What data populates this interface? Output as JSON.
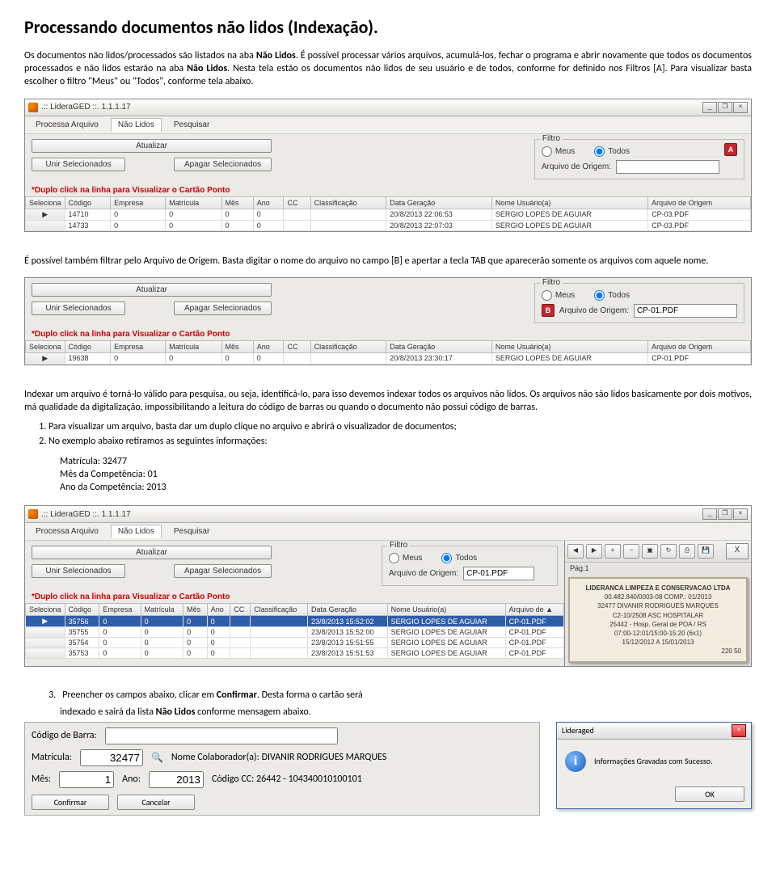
{
  "heading": "Processando documentos não lidos (Indexação).",
  "para1a": "Os documentos não lidos/processados são listados na aba ",
  "para1b": "Não Lidos",
  "para1c": ". É possível processar vários arquivos, acumulá-los, fechar o programa e abrir novamente que todos os documentos processados e não lidos estarão na aba ",
  "para1d": "Não Lidos",
  "para1e": ". Nesta tela estão os documentos não lidos de seu usuário e de todos, conforme for definido nos Filtros [A]. Para visualizar basta escolher o filtro \"Meus\" ou \"Todos\", conforme tela abaixo.",
  "app": {
    "title": ".:: LideraGED ::. 1.1.1.17",
    "tabs": [
      "Processa Arquivo",
      "Não Lidos",
      "Pesquisar"
    ],
    "buttons": {
      "atualizar": "Atualizar",
      "unir": "Unir Selecionados",
      "apagar": "Apagar Selecionados"
    },
    "filter": {
      "legend": "Filtro",
      "meus": "Meus",
      "todos": "Todos",
      "origem_label": "Arquivo de Origem:"
    },
    "markerA": "A",
    "markerB": "B",
    "redtext": "*Duplo click na linha para Visualizar o Cartão Ponto",
    "headers": [
      "Seleciona",
      "Código",
      "Empresa",
      "Matrícula",
      "Mês",
      "Ano",
      "CC",
      "Classificação",
      "Data Geração",
      "Nome Usuário(a)",
      "Arquivo de Origem"
    ],
    "headers2": [
      "Seleciona",
      "Código",
      "Empresa",
      "Matrícula",
      "Mês",
      "Ano",
      "CC",
      "Classificação",
      "Data Geração",
      "Nome Usuário(a)",
      "Arquivo de ▲"
    ]
  },
  "chart_data": [
    {
      "type": "table",
      "title": "Screenshot 1 — grid rows",
      "columns": [
        "Seleciona",
        "Código",
        "Empresa",
        "Matrícula",
        "Mês",
        "Ano",
        "CC",
        "Classificação",
        "Data Geração",
        "Nome Usuário(a)",
        "Arquivo de Origem"
      ],
      "rows": [
        [
          "",
          "14710",
          "0",
          "0",
          "0",
          "0",
          "",
          "",
          "20/8/2013 22:06:53",
          "SERGIO LOPES DE AGUIAR",
          "CP-03.PDF"
        ],
        [
          "",
          "14733",
          "0",
          "0",
          "0",
          "0",
          "",
          "",
          "20/8/2013 22:07:03",
          "SERGIO LOPES DE AGUIAR",
          "CP-03.PDF"
        ]
      ]
    },
    {
      "type": "table",
      "title": "Screenshot 2 — grid rows (Arquivo de Origem = CP-01.PDF)",
      "columns": [
        "Seleciona",
        "Código",
        "Empresa",
        "Matrícula",
        "Mês",
        "Ano",
        "CC",
        "Classificação",
        "Data Geração",
        "Nome Usuário(a)",
        "Arquivo de Origem"
      ],
      "rows": [
        [
          "",
          "19638",
          "0",
          "0",
          "0",
          "0",
          "",
          "",
          "20/8/2013 23:30:17",
          "SERGIO LOPES DE AGUIAR",
          "CP-01.PDF"
        ]
      ]
    },
    {
      "type": "table",
      "title": "Screenshot 3 — grid rows",
      "columns": [
        "Seleciona",
        "Código",
        "Empresa",
        "Matrícula",
        "Mês",
        "Ano",
        "CC",
        "Classificação",
        "Data Geração",
        "Nome Usuário(a)",
        "Arquivo de"
      ],
      "rows": [
        [
          "",
          "35756",
          "0",
          "0",
          "0",
          "0",
          "",
          "",
          "23/8/2013 15:52:02",
          "SERGIO LOPES DE AGUIAR",
          "CP-01.PDF"
        ],
        [
          "",
          "35755",
          "0",
          "0",
          "0",
          "0",
          "",
          "",
          "23/8/2013 15:52:00",
          "SERGIO LOPES DE AGUIAR",
          "CP-01.PDF"
        ],
        [
          "",
          "35754",
          "0",
          "0",
          "0",
          "0",
          "",
          "",
          "23/8/2013 15:51:55",
          "SERGIO LOPES DE AGUIAR",
          "CP-01.PDF"
        ],
        [
          "",
          "35753",
          "0",
          "0",
          "0",
          "0",
          "",
          "",
          "23/8/2013 15:51:53",
          "SERGIO LOPES DE AGUIAR",
          "CP-01.PDF"
        ]
      ]
    }
  ],
  "screenshot2_origem_value": "CP-01.PDF",
  "para2": "É possível também filtrar pelo Arquivo de Origem. Basta digitar o nome do arquivo no campo [B] e apertar a tecla TAB que aparecerão somente os arquivos com aquele nome.",
  "para3": "Indexar um arquivo é torná-lo válido para pesquisa, ou seja, identificá-lo, para isso devemos indexar todos os arquivos não lidos. Os arquivos não são lidos basicamente por dois motivos, má qualidade da digitalização, impossibilitando a leitura do código de barras ou quando o documento não possui código de barras.",
  "list": {
    "item1": "Para visualizar um arquivo, basta dar um duplo clique no arquivo e abrirá o visualizador de documentos;",
    "item2": "No exemplo abaixo retiramos as seguintes informações:"
  },
  "info": {
    "l1": "Matrícula: 32477",
    "l2": "Mês da Competência: 01",
    "l3": "Ano da Competência: 2013"
  },
  "viewer": {
    "x": "X",
    "pag": "Pág.1",
    "card": {
      "l1": "LIDERANCA LIMPEZA E CONSERVACAO LTDA",
      "l2": "00.482.840/0003-08            COMP.: 01/2013",
      "l3": "32477  DIVANIR RODRIGUES MARQUES",
      "l4": "C2-10/2508 ASC HOSPITALAR",
      "l5": "25442 - Hosp. Geral de POA / RS",
      "l6": "07:00-12:01/15:00-15:20 (6x1)",
      "l7": "15/12/2012 A 15/01/2013",
      "l8": "220 50"
    }
  },
  "para4a": "Preencher os campos abaixo, ",
  "para4b": "clicar em ",
  "para4c": "Confirmar",
  "para4d": ". Desta forma o cartão será",
  "para4e": "indexado e sairá da lista ",
  "para4f": "Não Lidos",
  "para4g": " conforme mensagem abaixo.",
  "item3num": "3.",
  "form": {
    "codigo_barra": "Código de Barra:",
    "matricula": "Matrícula:",
    "matricula_val": "32477",
    "nome": "Nome Colaborador(a): DIVANIR RODRIGUES MARQUES",
    "mes": "Mês:",
    "mes_val": "1",
    "ano": "Ano:",
    "ano_val": "2013",
    "cc": "Código CC: 26442 - 104340010100101",
    "confirmar": "Confirmar",
    "cancelar": "Cancelar"
  },
  "dialog": {
    "title": "Lideraged",
    "msg": "Informações Gravadas com Sucesso.",
    "ok": "OK"
  }
}
